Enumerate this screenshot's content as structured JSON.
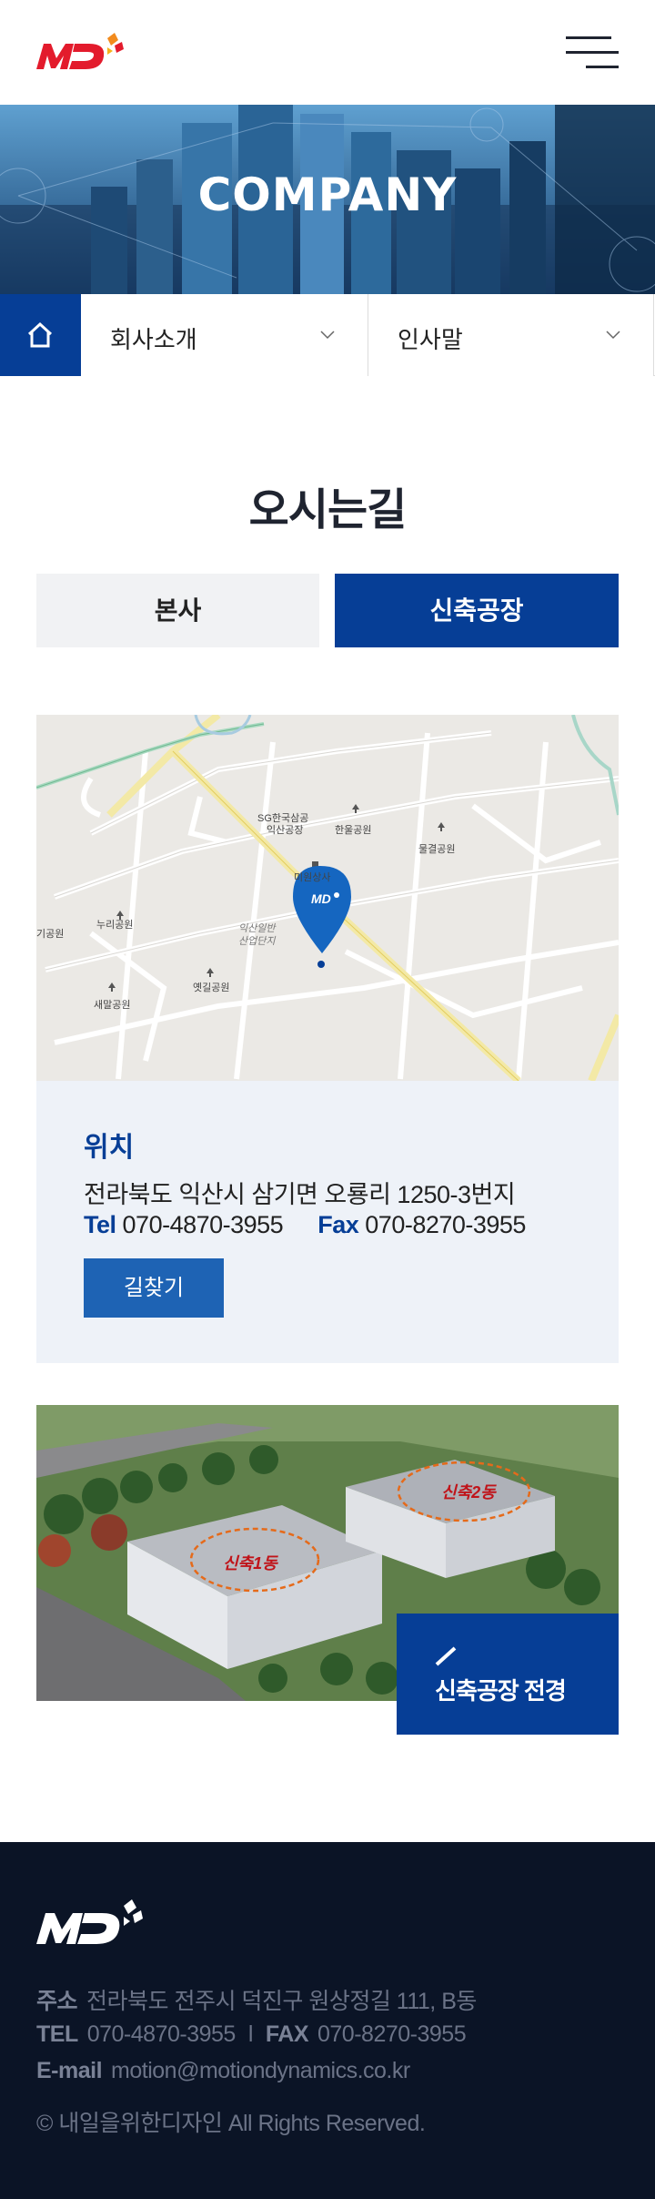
{
  "header": {
    "logo_text": "MD",
    "menu_icon": "hamburger-menu-icon"
  },
  "hero": {
    "title": "COMPANY"
  },
  "subnav": {
    "home_icon": "home-icon",
    "dropdown1": "회사소개",
    "dropdown2": "인사말"
  },
  "main": {
    "title": "오시는길",
    "tabs": [
      {
        "label": "본사",
        "active": false
      },
      {
        "label": "신축공장",
        "active": true
      }
    ]
  },
  "map": {
    "marker_text": "MD",
    "labels": {
      "sg": "SG한국삼공",
      "sg2": "익산공장",
      "hanul": "한울공원",
      "mulgyeol": "물결공원",
      "miwon": "미원상사",
      "nuri": "누리공원",
      "gi": "기공원",
      "ind1": "익산일반",
      "ind2": "산업단지",
      "yetgil": "옛길공원",
      "saebom": "새말공원"
    }
  },
  "info": {
    "heading": "위치",
    "address": "전라북도 익산시 삼기면 오룡리 1250-3번지",
    "tel_label": "Tel",
    "tel": "070-4870-3955",
    "fax_label": "Fax",
    "fax": "070-8270-3955",
    "route_button": "길찾기"
  },
  "photo": {
    "building1": "신축1동",
    "building2": "신축2동",
    "view_button": "신축공장 전경"
  },
  "footer": {
    "addr_label": "주소",
    "addr": "전라북도 전주시 덕진구 원상정길 111, B동",
    "tel_label": "TEL",
    "tel": "070-4870-3955",
    "separator": "l",
    "fax_label": "FAX",
    "fax": "070-8270-3955",
    "email_label": "E-mail",
    "email": "motion@motiondynamics.co.kr",
    "copyright": "© 내일을위한디자인  All Rights Reserved."
  },
  "colors": {
    "brand_blue": "#063e96",
    "brand_red": "#e31b2c",
    "footer_bg": "#0b1426",
    "info_bg": "#eef2f8"
  }
}
